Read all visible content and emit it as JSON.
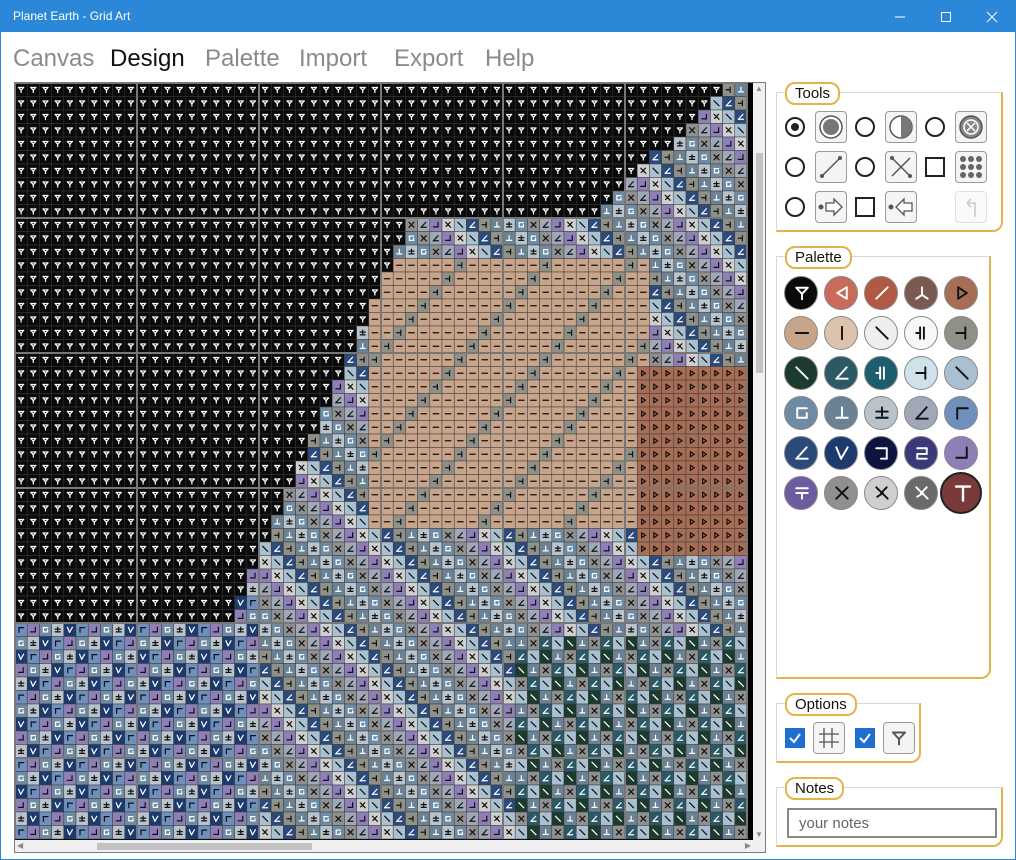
{
  "window": {
    "title": "Planet Earth - Grid Art",
    "controls": [
      "minimize-icon",
      "maximize-icon",
      "close-icon"
    ],
    "accent": "#2b88d8"
  },
  "menu": {
    "items": [
      {
        "label": "Canvas",
        "active": false
      },
      {
        "label": "Design",
        "active": true
      },
      {
        "label": "Palette",
        "active": false
      },
      {
        "label": "Import",
        "active": false
      },
      {
        "label": "Export",
        "active": false
      },
      {
        "label": "Help",
        "active": false
      }
    ]
  },
  "tools": {
    "label": "Tools",
    "items": [
      {
        "icon": "circle-fill-icon",
        "selector": "radio",
        "selected": true
      },
      {
        "icon": "circle-half-icon",
        "selector": "radio",
        "selected": false
      },
      {
        "icon": "circle-x-icon",
        "selector": "radio",
        "selected": false
      },
      {
        "icon": "line-icon",
        "selector": "radio",
        "selected": false
      },
      {
        "icon": "cross-line-icon",
        "selector": "radio",
        "selected": false
      },
      {
        "icon": "dot-grid-icon",
        "selector": "checkbox",
        "selected": false
      },
      {
        "icon": "arrow-right-icon",
        "selector": "radio",
        "selected": false
      },
      {
        "icon": "arrow-left-icon",
        "selector": "checkbox",
        "selected": false
      },
      {
        "icon": "undo-icon",
        "selector": "none",
        "selected": false
      }
    ]
  },
  "palette": {
    "label": "Palette",
    "colors": [
      {
        "color": "#0a0a0a",
        "icon": "fork-icon",
        "glyph": "#ffffff"
      },
      {
        "color": "#c96a5a",
        "icon": "angle-icon",
        "glyph": "#ffffff"
      },
      {
        "color": "#b05a45",
        "icon": "slash-icon",
        "glyph": "#ffffff"
      },
      {
        "color": "#7a5a50",
        "icon": "y-icon",
        "glyph": "#ffffff"
      },
      {
        "color": "#a86e55",
        "icon": "play-icon",
        "glyph": "#111111"
      },
      {
        "color": "#c8a58a",
        "icon": "dash-icon",
        "glyph": "#111111"
      },
      {
        "color": "#dcc3ad",
        "icon": "bar-icon",
        "glyph": "#111111"
      },
      {
        "color": "#eeeeee",
        "icon": "backslash-icon",
        "glyph": "#111111"
      },
      {
        "color": "#f7f7f7",
        "icon": "double-bar-icon",
        "glyph": "#111111"
      },
      {
        "color": "#8f9088",
        "icon": "t-side-icon",
        "glyph": "#111111"
      },
      {
        "color": "#1c3a2e",
        "icon": "backslash-icon",
        "glyph": "#ffffff"
      },
      {
        "color": "#2b5a66",
        "icon": "slash-corner-icon",
        "glyph": "#ffffff"
      },
      {
        "color": "#1e5d6e",
        "icon": "double-bar-icon",
        "glyph": "#ffffff"
      },
      {
        "color": "#cfe1ea",
        "icon": "t-side-icon",
        "glyph": "#111111"
      },
      {
        "color": "#a8c0cf",
        "icon": "backslash-icon",
        "glyph": "#111111"
      },
      {
        "color": "#6e8ba3",
        "icon": "square-corner-icon",
        "glyph": "#ffffff"
      },
      {
        "color": "#6a8294",
        "icon": "up-tack-icon",
        "glyph": "#ffffff"
      },
      {
        "color": "#b8c3cc",
        "icon": "plus-minus-icon",
        "glyph": "#111111"
      },
      {
        "color": "#a0a8b8",
        "icon": "slash-corner-icon",
        "glyph": "#111111"
      },
      {
        "color": "#6f8fbd",
        "icon": "corner-icon",
        "glyph": "#111111"
      },
      {
        "color": "#2c4a7a",
        "icon": "slash-corner-icon",
        "glyph": "#ffffff"
      },
      {
        "color": "#1c3a6e",
        "icon": "v-slash-icon",
        "glyph": "#ffffff"
      },
      {
        "color": "#0e1440",
        "icon": "hook-icon",
        "glyph": "#ffffff"
      },
      {
        "color": "#3a3a78",
        "icon": "loop-icon",
        "glyph": "#ffffff"
      },
      {
        "color": "#8f7fb7",
        "icon": "corner-br-icon",
        "glyph": "#111111"
      },
      {
        "color": "#6b5ca0",
        "icon": "t-bar-icon",
        "glyph": "#ffffff"
      },
      {
        "color": "#909090",
        "icon": "x-icon",
        "glyph": "#111111"
      },
      {
        "color": "#cfcfcf",
        "icon": "cross-slash-icon",
        "glyph": "#111111"
      },
      {
        "color": "#6a6a6a",
        "icon": "cross-slash-icon",
        "glyph": "#ffffff"
      },
      {
        "color": "#7a3a3a",
        "icon": "t-icon",
        "glyph": "#ffffff",
        "selected": true
      }
    ]
  },
  "options": {
    "label": "Options",
    "items": [
      {
        "icon": "grid-icon",
        "checked": true
      },
      {
        "icon": "fork-icon",
        "checked": true
      }
    ]
  },
  "notes": {
    "label": "Notes",
    "placeholder": "your notes",
    "value": ""
  }
}
